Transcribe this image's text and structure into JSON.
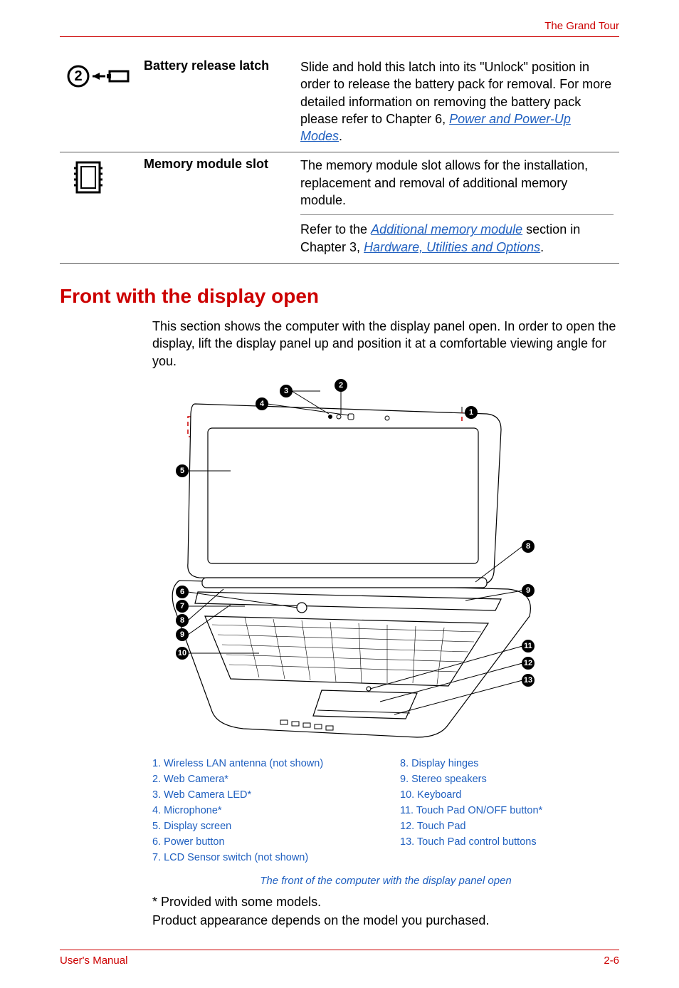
{
  "header": {
    "section_title": "The Grand Tour"
  },
  "features": [
    {
      "name": "Battery release latch",
      "desc_plain_a": "Slide and hold this latch into its \"Unlock\" position in order to release the battery pack for removal. For more detailed information on removing the battery pack please refer to Chapter 6, ",
      "link_a": "Power and Power-Up Modes",
      "tail_a": "."
    },
    {
      "name": "Memory module slot",
      "desc_plain_a": "The memory module slot allows for the installation, replacement and removal of additional memory module.",
      "desc_plain_b": "Refer to the ",
      "link_b1": "Additional memory module",
      "mid_b": " section in Chapter 3, ",
      "link_b2": "Hardware, Utilities and Options",
      "tail_b": "."
    }
  ],
  "section_heading": "Front with the display open",
  "intro_paragraph": "This section shows the computer with the display panel open. In order to open the display, lift the display panel up and position it at a comfortable viewing angle for you.",
  "legend_left": [
    "1. Wireless LAN antenna (not shown)",
    "2. Web Camera*",
    "3. Web Camera LED*",
    "4. Microphone*",
    "5. Display screen",
    "6. Power button",
    "7. LCD Sensor switch (not shown)"
  ],
  "legend_right": [
    "8. Display hinges",
    "9. Stereo speakers",
    "10. Keyboard",
    "11. Touch Pad ON/OFF button*",
    "12. Touch Pad",
    "13. Touch Pad control buttons"
  ],
  "figure_caption": "The front of the computer with the display panel open",
  "footnote": "* Provided with some models.",
  "appearance_note": "Product appearance depends on the model you purchased.",
  "footer": {
    "left": "User's Manual",
    "right": "2-6"
  }
}
